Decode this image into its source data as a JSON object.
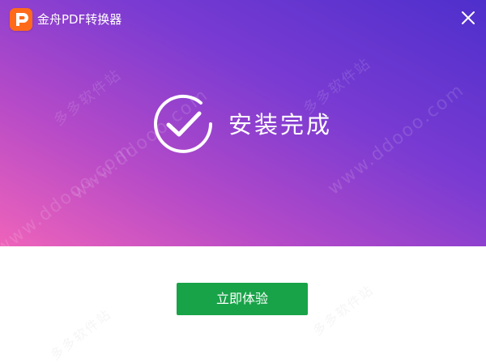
{
  "window": {
    "title": "金舟PDF转换器",
    "close_icon": "close-icon",
    "logo_icon": "app-logo-icon"
  },
  "hero": {
    "status_icon": "check-circle-icon",
    "status_text": "安装完成",
    "gradient_colors": [
      "#ee63ba",
      "#b54ac8",
      "#7a3bd2",
      "#4e2fcc"
    ]
  },
  "footer": {
    "primary_button_label": "立即体验",
    "primary_button_color": "#18a348"
  },
  "watermark": {
    "cn": "多多软件站",
    "url": "www.ddooo.com"
  }
}
